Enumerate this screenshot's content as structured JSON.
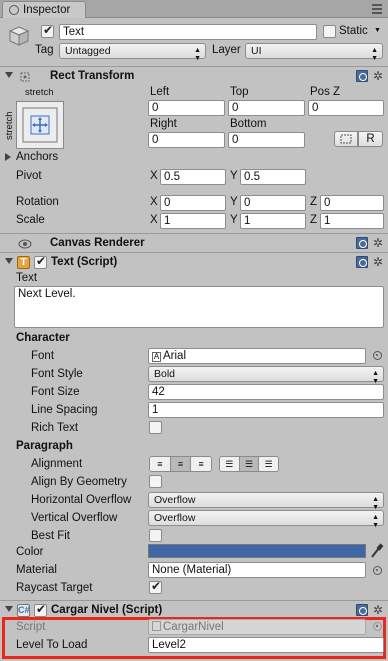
{
  "window": {
    "tab_label": "Inspector"
  },
  "object": {
    "name": "Text",
    "static_label": "Static",
    "tag_label": "Tag",
    "tag_value": "Untagged",
    "layer_label": "Layer",
    "layer_value": "UI"
  },
  "rect_transform": {
    "title": "Rect Transform",
    "anchor_top_label": "stretch",
    "anchor_side_label": "stretch",
    "left_label": "Left",
    "left_value": "0",
    "top_label": "Top",
    "top_value": "0",
    "posz_label": "Pos Z",
    "posz_value": "0",
    "right_label": "Right",
    "right_value": "0",
    "bottom_label": "Bottom",
    "bottom_value": "0",
    "r_button": "R",
    "anchors_label": "Anchors",
    "pivot_label": "Pivot",
    "pivot_x": "0.5",
    "pivot_y": "0.5",
    "rotation_label": "Rotation",
    "rot_x": "0",
    "rot_y": "0",
    "rot_z": "0",
    "scale_label": "Scale",
    "scale_x": "1",
    "scale_y": "1",
    "scale_z": "1",
    "x_label": "X",
    "y_label": "Y",
    "z_label": "Z"
  },
  "canvas_renderer": {
    "title": "Canvas Renderer"
  },
  "text_script": {
    "title": "Text (Script)",
    "text_label": "Text",
    "text_value": "Next Level.",
    "character_label": "Character",
    "font_label": "Font",
    "font_value": "Arial",
    "font_style_label": "Font Style",
    "font_style_value": "Bold",
    "font_size_label": "Font Size",
    "font_size_value": "42",
    "line_spacing_label": "Line Spacing",
    "line_spacing_value": "1",
    "rich_text_label": "Rich Text",
    "paragraph_label": "Paragraph",
    "alignment_label": "Alignment",
    "align_geometry_label": "Align By Geometry",
    "h_overflow_label": "Horizontal Overflow",
    "h_overflow_value": "Overflow",
    "v_overflow_label": "Vertical Overflow",
    "v_overflow_value": "Overflow",
    "best_fit_label": "Best Fit",
    "color_label": "Color",
    "color_value": "#3f66a7",
    "material_label": "Material",
    "material_value": "None (Material)",
    "raycast_label": "Raycast Target"
  },
  "cargar_nivel": {
    "title": "Cargar Nivel (Script)",
    "script_label": "Script",
    "script_value": "CargarNivel",
    "level_label": "Level To Load",
    "level_value": "Level2"
  },
  "colors": {
    "highlight": "#e8281e",
    "panel": "#c2c2c2"
  }
}
